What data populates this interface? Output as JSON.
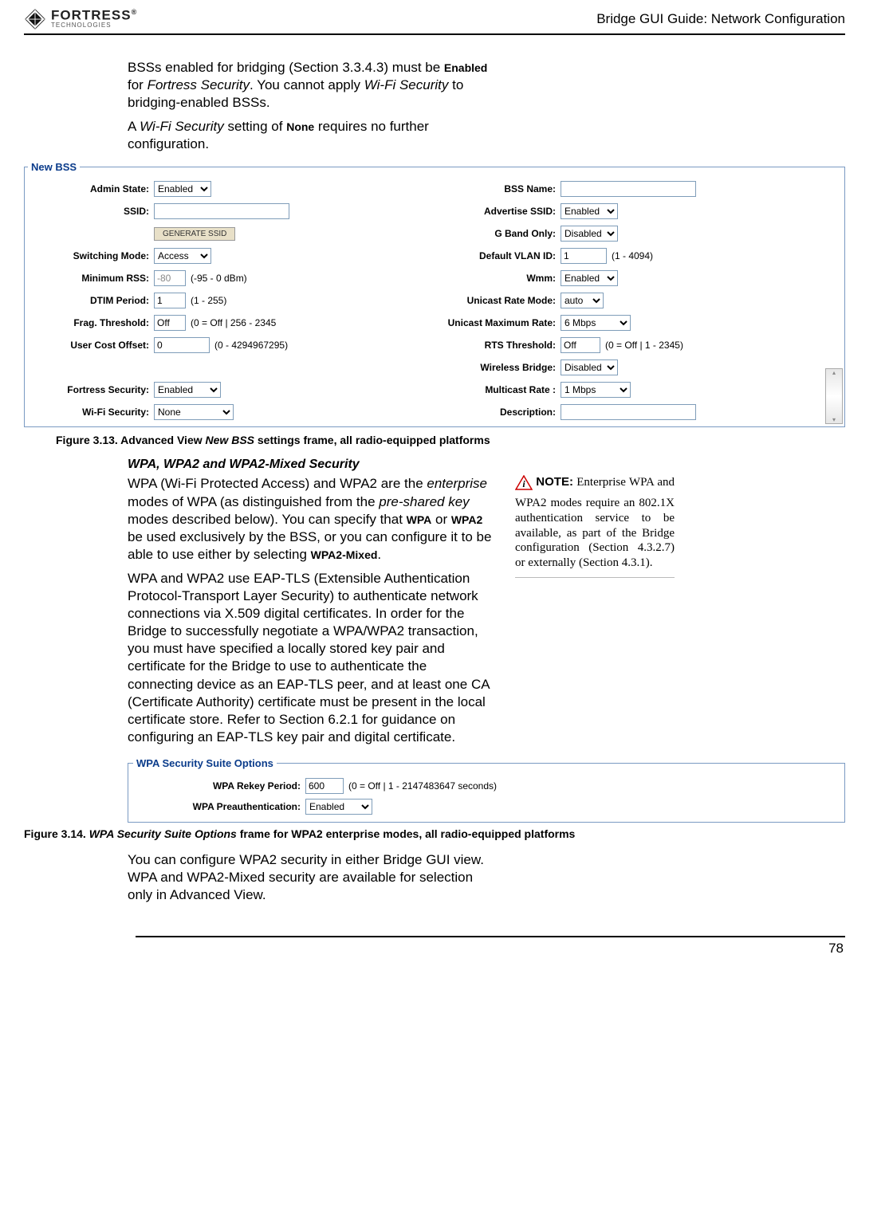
{
  "header": {
    "brand1": "FORTRESS",
    "brand2": "TECHNOLOGIES",
    "title": "Bridge GUI Guide: Network Configuration"
  },
  "intro": {
    "p1a": "BSSs enabled for bridging (Section 3.3.4.3) must be ",
    "p1b": "Enabled",
    "p1c": " for ",
    "p1d": "Fortress Security",
    "p1e": ". You cannot apply ",
    "p1f": "Wi-Fi Security",
    "p1g": " to bridging-enabled BSSs.",
    "p2a": "A ",
    "p2b": "Wi-Fi Security",
    "p2c": " setting of ",
    "p2d": "None",
    "p2e": " requires no further configuration."
  },
  "fig313": {
    "legend": "New BSS",
    "admin_state_label": "Admin State:",
    "admin_state": "Enabled",
    "bss_name_label": "BSS Name:",
    "bss_name": "",
    "ssid_label": "SSID:",
    "ssid": "",
    "adv_ssid_label": "Advertise SSID:",
    "adv_ssid": "Enabled",
    "gen_ssid_btn": "GENERATE SSID",
    "gband_label": "G Band Only:",
    "gband": "Disabled",
    "switch_mode_label": "Switching Mode:",
    "switch_mode": "Access",
    "vlan_label": "Default VLAN ID:",
    "vlan": "1",
    "vlan_hint": "(1 - 4094)",
    "min_rss_label": "Minimum RSS:",
    "min_rss": "-80",
    "min_rss_hint": "(-95 - 0 dBm)",
    "wmm_label": "Wmm:",
    "wmm": "Enabled",
    "dtim_label": "DTIM Period:",
    "dtim": "1",
    "dtim_hint": "(1 - 255)",
    "urate_mode_label": "Unicast Rate Mode:",
    "urate_mode": "auto",
    "frag_label": "Frag. Threshold:",
    "frag": "Off",
    "frag_hint": "(0 = Off | 256 - 2345",
    "umax_label": "Unicast Maximum Rate:",
    "umax": "6 Mbps",
    "cost_label": "User Cost Offset:",
    "cost": "0",
    "cost_hint": "(0 - 4294967295)",
    "rts_label": "RTS Threshold:",
    "rts": "Off",
    "rts_hint": "(0 = Off | 1 - 2345)",
    "wbridge_label": "Wireless Bridge:",
    "wbridge": "Disabled",
    "fsec_label": "Fortress Security:",
    "fsec": "Enabled",
    "mcast_label": "Multicast Rate :",
    "mcast": "1 Mbps",
    "wifi_label": "Wi-Fi Security:",
    "wifi": "None",
    "desc_label": "Description:",
    "caption_a": "Figure 3.13. Advanced View ",
    "caption_b": "New BSS",
    "caption_c": " settings frame, all radio-equipped platforms"
  },
  "section": {
    "title": "WPA, WPA2 and WPA2-Mixed Security",
    "p1_a": "WPA (Wi-Fi Protected Access) and WPA2 are the ",
    "p1_b": "enterprise",
    "p1_c": " modes of WPA (as distinguished from the ",
    "p1_d": "pre-shared key",
    "p1_e": " modes described below). You can specify that ",
    "p1_f": "WPA",
    "p1_g": " or ",
    "p1_h": "WPA2",
    "p1_i": " be used exclusively by the BSS, or you can configure it to be able to use either by selecting ",
    "p1_j": "WPA2-Mixed",
    "p1_k": ".",
    "p2": "WPA and WPA2 use EAP-TLS (Extensible Authentication Protocol-Transport Layer Security) to authenticate network connections via X.509 digital certificates. In order for the Bridge to successfully negotiate a WPA/WPA2 transaction, you must have specified a locally stored key pair and certificate for the Bridge to use to authenticate the connecting device as an EAP-TLS peer, and at least one CA (Certificate Authority) certificate must be present in the local certificate store. Refer to Section 6.2.1 for guidance on configuring an EAP-TLS key pair and digital certificate."
  },
  "note": {
    "label": "NOTE:",
    "text": " Enterprise WPA and WPA2 modes require an 802.1X authentication service to be available, as part of the Bridge configuration (Section 4.3.2.7) or externally (Section 4.3.1)."
  },
  "fig314": {
    "legend": "WPA Security Suite Options",
    "rekey_label": "WPA Rekey Period:",
    "rekey": "600",
    "rekey_hint": "(0 = Off | 1 - 2147483647 seconds)",
    "preauth_label": "WPA Preauthentication:",
    "preauth": "Enabled",
    "caption_a": "Figure 3.14. ",
    "caption_b": "WPA Security Suite Options",
    "caption_c": " frame for WPA2 enterprise modes, all radio-equipped platforms"
  },
  "closing": {
    "p": "You can configure WPA2 security in either Bridge GUI view. WPA and WPA2-Mixed security are available for selection only in Advanced View."
  },
  "page_num": "78"
}
